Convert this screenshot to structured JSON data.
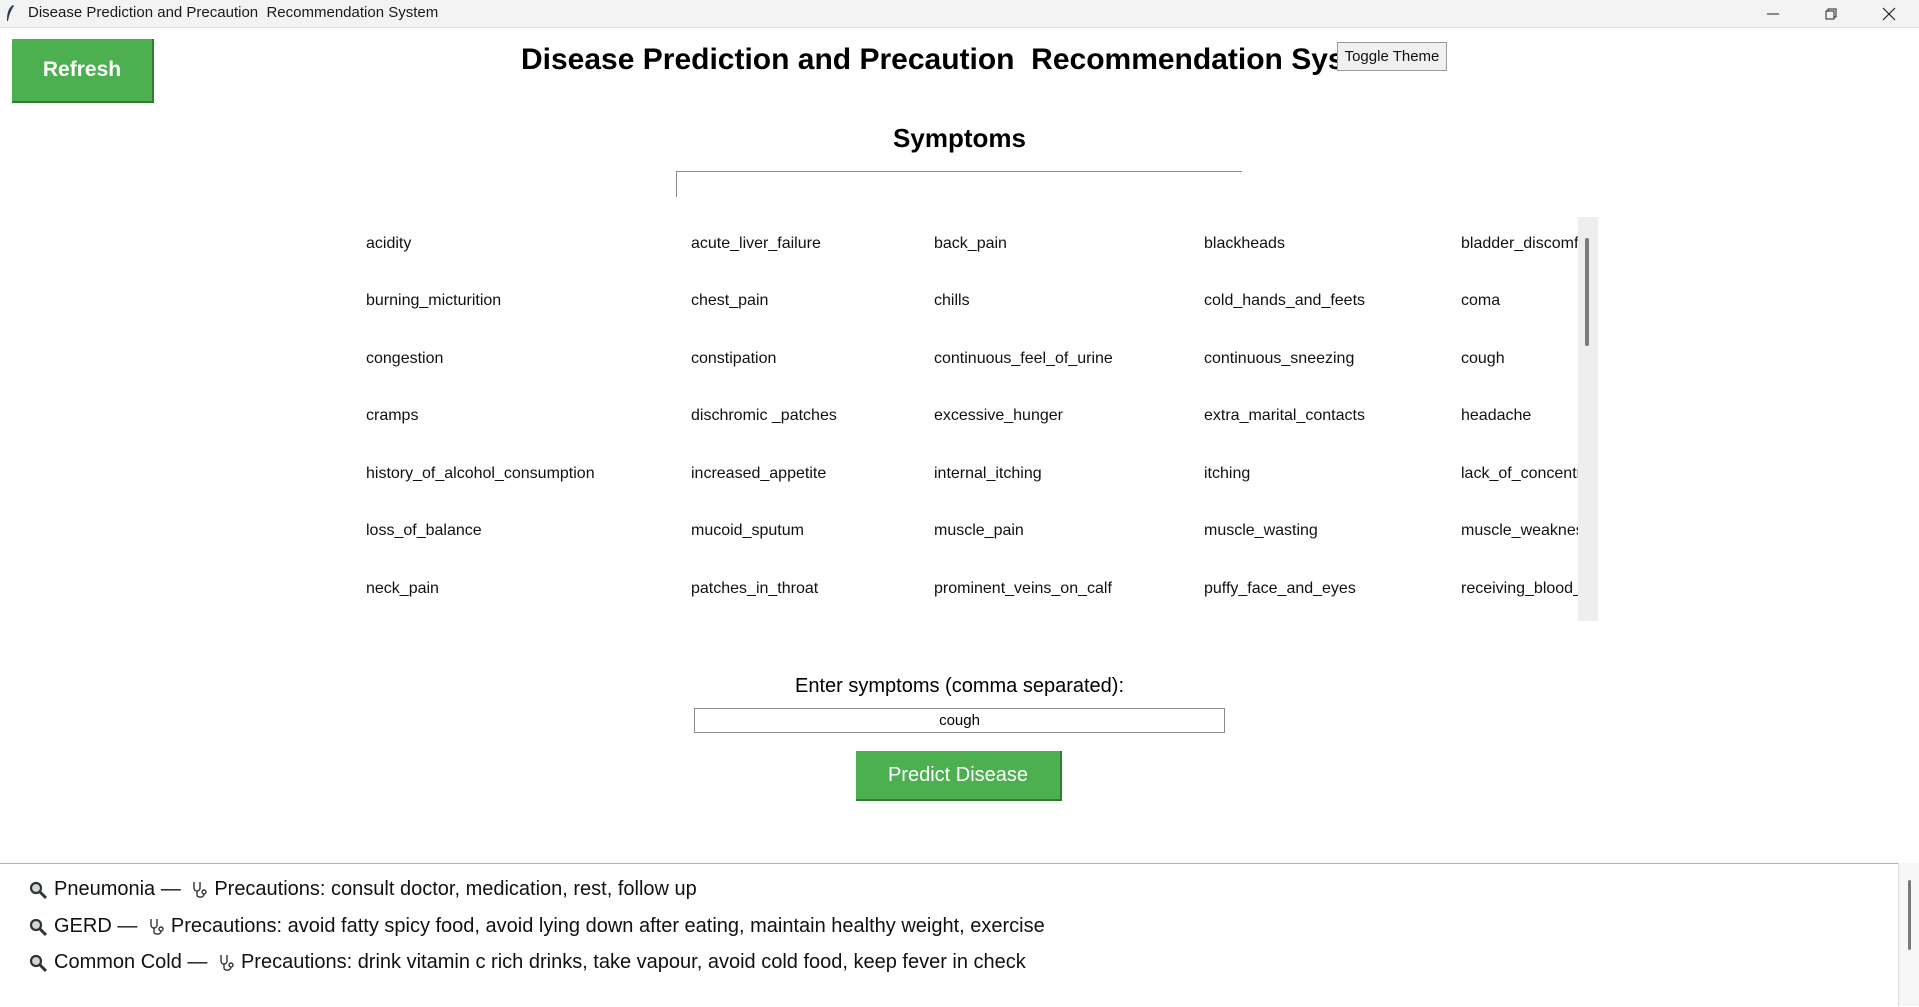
{
  "window": {
    "title": "Disease Prediction and Precaution  Recommendation System",
    "minimize_glyph": "—",
    "maximize_glyph": "❐",
    "close_glyph": "✕"
  },
  "toolbar": {
    "refresh_label": "Refresh",
    "toggle_theme_label": "Toggle Theme"
  },
  "header": {
    "title": "Disease Prediction and Precaution  Recommendation System"
  },
  "symptoms": {
    "label": "Symptoms",
    "filter_value": "",
    "grid": [
      [
        "acidity",
        "acute_liver_failure",
        "back_pain",
        "blackheads",
        "bladder_discomfort"
      ],
      [
        "burning_micturition",
        "chest_pain",
        "chills",
        "cold_hands_and_feets",
        "coma"
      ],
      [
        "congestion",
        "constipation",
        "continuous_feel_of_urine",
        "continuous_sneezing",
        "cough"
      ],
      [
        "cramps",
        "dischromic _patches",
        "excessive_hunger",
        "extra_marital_contacts",
        "headache"
      ],
      [
        "history_of_alcohol_consumption",
        "increased_appetite",
        "internal_itching",
        "itching",
        "lack_of_concentration"
      ],
      [
        "loss_of_balance",
        "mucoid_sputum",
        "muscle_pain",
        "muscle_wasting",
        "muscle_weakness"
      ],
      [
        "neck_pain",
        "patches_in_throat",
        "prominent_veins_on_calf",
        "puffy_face_and_eyes",
        "receiving_blood_transfusion"
      ]
    ]
  },
  "input": {
    "label": "Enter symptoms (comma separated):",
    "value": "cough"
  },
  "predict_label": "Predict Disease",
  "results": [
    {
      "disease": "Pneumonia",
      "separator": " — ",
      "prefix": "Precautions: ",
      "precautions": "consult doctor, medication, rest, follow up"
    },
    {
      "disease": "GERD",
      "separator": " — ",
      "prefix": "Precautions: ",
      "precautions": "avoid fatty spicy food, avoid lying down after eating, maintain healthy weight, exercise"
    },
    {
      "disease": "Common Cold",
      "separator": " — ",
      "prefix": "Precautions: ",
      "precautions": "drink vitamin c rich drinks, take vapour, avoid cold food, keep fever in check"
    }
  ],
  "icons": {
    "result_search": "magnifier-icon",
    "result_precaution": "stethoscope-icon",
    "app": "feather-icon"
  },
  "colors": {
    "accent": "#4caf50",
    "accent_dark": "#2e7d32"
  }
}
